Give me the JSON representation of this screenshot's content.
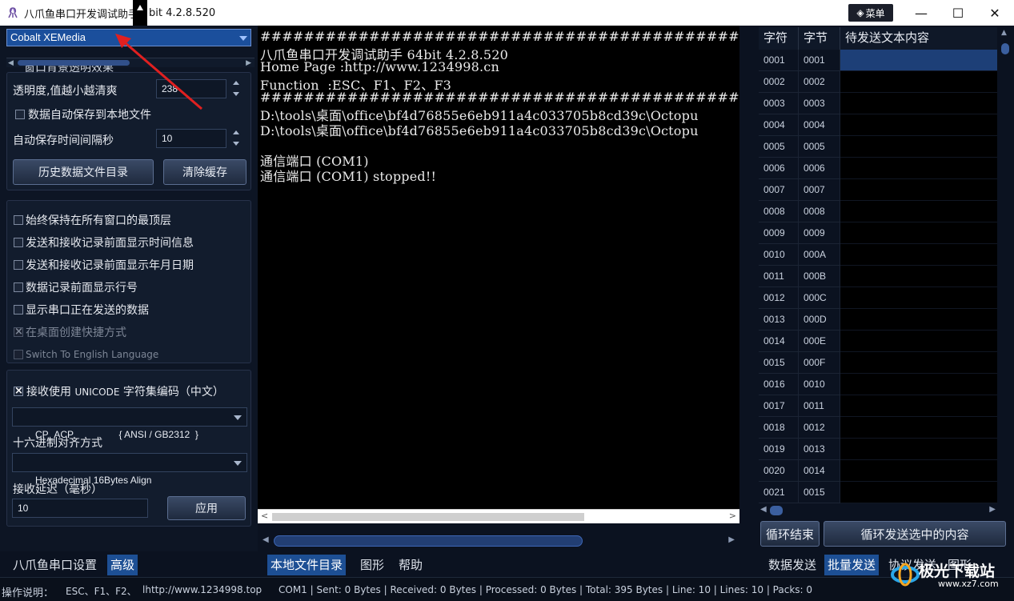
{
  "window": {
    "title": "八爪鱼串口开发调试助手",
    "title_suffix": "bit 4.2.8.520",
    "menu_label": "菜单"
  },
  "left": {
    "theme_select": "Cobalt XEMedia",
    "partial_label": "窗口背景透明效果",
    "transparency_label": "透明度,值越小越清爽",
    "transparency_value": "238",
    "autosave_label": "数据自动保存到本地文件",
    "autosave_interval_label": "自动保存时间间隔秒",
    "autosave_interval_value": "10",
    "history_button": "历史数据文件目录",
    "clear_button": "清除缓存",
    "options": [
      {
        "label": "始终保持在所有窗口的最顶层",
        "checked": false,
        "enabled": true
      },
      {
        "label": "发送和接收记录前面显示时间信息",
        "checked": false,
        "enabled": true
      },
      {
        "label": "发送和接收记录前面显示年月日期",
        "checked": false,
        "enabled": true
      },
      {
        "label": "数据记录前面显示行号",
        "checked": false,
        "enabled": true
      },
      {
        "label": "显示串口正在发送的数据",
        "checked": false,
        "enabled": true
      },
      {
        "label": "在桌面创建快捷方式",
        "checked": true,
        "enabled": false
      },
      {
        "label": "Switch To English Language",
        "checked": false,
        "enabled": false
      }
    ],
    "unicode_prefix": "接收使用",
    "unicode_word": "UNICODE",
    "unicode_suffix": "字符集编码（中文）",
    "codepage_value": "CP_ACP                 { ANSI / GB2312  }",
    "hex_align_label": "十六进制对齐方式",
    "hex_align_value": "Hexadecimal 16Bytes Align",
    "delay_label": "接收延迟（毫秒）",
    "delay_value": "10",
    "apply_button": "应用",
    "tabs": [
      {
        "label": "八爪鱼串口设置",
        "active": false
      },
      {
        "label": "高级",
        "active": true
      }
    ]
  },
  "terminal": {
    "lines": [
      "#################################################",
      "八爪鱼串口开发调试助手 64bit 4.2.8.520",
      "Home Page :http://www.1234998.cn",
      "Function  :ESC、F1、F2、F3",
      "#################################################",
      "D:\\tools\\桌面\\office\\bf4d76855e6eb911a4c033705b8cd39c\\Octopu",
      "D:\\tools\\桌面\\office\\bf4d76855e6eb911a4c033705b8cd39c\\Octopu",
      "",
      "通信端口 (COM1)",
      "通信端口 (COM1) stopped!!"
    ],
    "tabs": [
      {
        "label": "本地文件目录",
        "active": true
      },
      {
        "label": "图形",
        "active": false
      },
      {
        "label": "帮助",
        "active": false
      }
    ]
  },
  "grid": {
    "headers": [
      "字符",
      "字节",
      "待发送文本内容"
    ],
    "rows": [
      [
        "0001",
        "0001"
      ],
      [
        "0002",
        "0002"
      ],
      [
        "0003",
        "0003"
      ],
      [
        "0004",
        "0004"
      ],
      [
        "0005",
        "0005"
      ],
      [
        "0006",
        "0006"
      ],
      [
        "0007",
        "0007"
      ],
      [
        "0008",
        "0008"
      ],
      [
        "0009",
        "0009"
      ],
      [
        "0010",
        "000A"
      ],
      [
        "0011",
        "000B"
      ],
      [
        "0012",
        "000C"
      ],
      [
        "0013",
        "000D"
      ],
      [
        "0014",
        "000E"
      ],
      [
        "0015",
        "000F"
      ],
      [
        "0016",
        "0010"
      ],
      [
        "0017",
        "0011"
      ],
      [
        "0018",
        "0012"
      ],
      [
        "0019",
        "0013"
      ],
      [
        "0020",
        "0014"
      ],
      [
        "0021",
        "0015"
      ]
    ],
    "loop_end_button": "循环结束",
    "loop_send_button": "循环发送选中的内容",
    "tabs": [
      {
        "label": "数据发送",
        "active": false
      },
      {
        "label": "批量发送",
        "active": true
      },
      {
        "label": "协议发送",
        "active": false
      },
      {
        "label": "图形",
        "active": false
      }
    ]
  },
  "status": {
    "help_label": "操作说明：",
    "keys": "ESC、F1、F2、",
    "url": "lhttp://www.1234998.top",
    "port_info": "COM1 | Sent: 0 Bytes | Received: 0 Bytes | Processed: 0 Bytes | Total: 395 Bytes | Line: 10 | Lines: 10 | Packs: 0"
  },
  "watermark": {
    "brand": "极光下载站",
    "domain": "www.xz7.com"
  },
  "colors": {
    "accent": "#1d4f94",
    "selection": "#1d3f77",
    "background": "#0b1220",
    "annotation_arrow": "#e02020"
  }
}
